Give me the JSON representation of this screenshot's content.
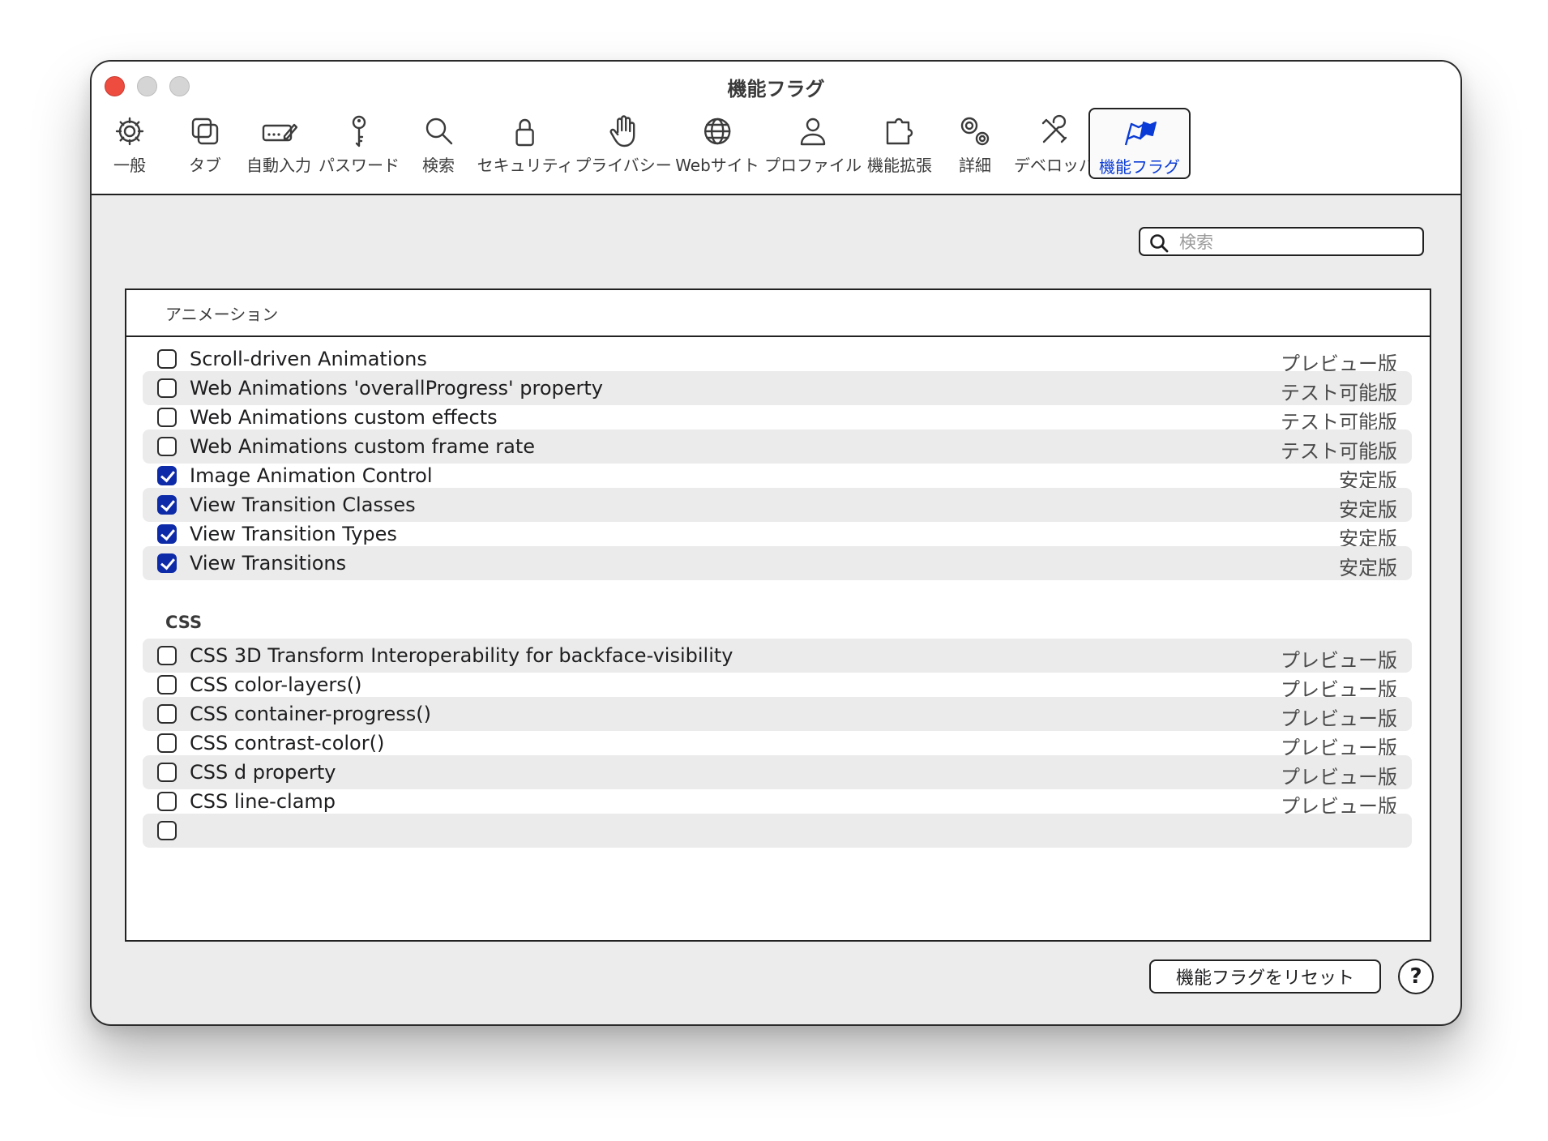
{
  "window": {
    "title": "機能フラグ"
  },
  "toolbar": {
    "tabs": [
      {
        "label": "一般",
        "icon": "gear-icon"
      },
      {
        "label": "タブ",
        "icon": "tabs-icon"
      },
      {
        "label": "自動入力",
        "icon": "autofill-icon"
      },
      {
        "label": "パスワード",
        "icon": "key-icon"
      },
      {
        "label": "検索",
        "icon": "search-icon"
      },
      {
        "label": "セキュリティ",
        "icon": "lock-icon"
      },
      {
        "label": "プライバシー",
        "icon": "hand-icon"
      },
      {
        "label": "Webサイト",
        "icon": "globe-icon"
      },
      {
        "label": "プロファイル",
        "icon": "person-icon"
      },
      {
        "label": "機能拡張",
        "icon": "puzzle-icon"
      },
      {
        "label": "詳細",
        "icon": "gears-icon"
      },
      {
        "label": "デベロッパ",
        "icon": "tools-icon"
      },
      {
        "label": "機能フラグ",
        "icon": "flags-icon",
        "active": true
      }
    ]
  },
  "search": {
    "placeholder": "検索",
    "value": ""
  },
  "sections": [
    {
      "title": "アニメーション",
      "items": [
        {
          "name": "Scroll-driven Animations",
          "status": "プレビュー版",
          "checked": false
        },
        {
          "name": "Web Animations 'overallProgress' property",
          "status": "テスト可能版",
          "checked": false
        },
        {
          "name": "Web Animations custom effects",
          "status": "テスト可能版",
          "checked": false
        },
        {
          "name": "Web Animations custom frame rate",
          "status": "テスト可能版",
          "checked": false
        },
        {
          "name": "Image Animation Control",
          "status": "安定版",
          "checked": true
        },
        {
          "name": "View Transition Classes",
          "status": "安定版",
          "checked": true
        },
        {
          "name": "View Transition Types",
          "status": "安定版",
          "checked": true
        },
        {
          "name": "View Transitions",
          "status": "安定版",
          "checked": true
        }
      ]
    },
    {
      "title": "CSS",
      "items": [
        {
          "name": "CSS 3D Transform Interoperability for backface-visibility",
          "status": "プレビュー版",
          "checked": false
        },
        {
          "name": "CSS color-layers()",
          "status": "プレビュー版",
          "checked": false
        },
        {
          "name": "CSS container-progress()",
          "status": "プレビュー版",
          "checked": false
        },
        {
          "name": "CSS contrast-color()",
          "status": "プレビュー版",
          "checked": false
        },
        {
          "name": "CSS d property",
          "status": "プレビュー版",
          "checked": false
        },
        {
          "name": "CSS line-clamp",
          "status": "プレビュー版",
          "checked": false
        }
      ]
    }
  ],
  "footer": {
    "reset_label": "機能フラグをリセット",
    "help_label": "?"
  },
  "colors": {
    "accent": "#0d2ba8",
    "active_tab": "#0a3bd6",
    "close": "#ed4c3f"
  }
}
